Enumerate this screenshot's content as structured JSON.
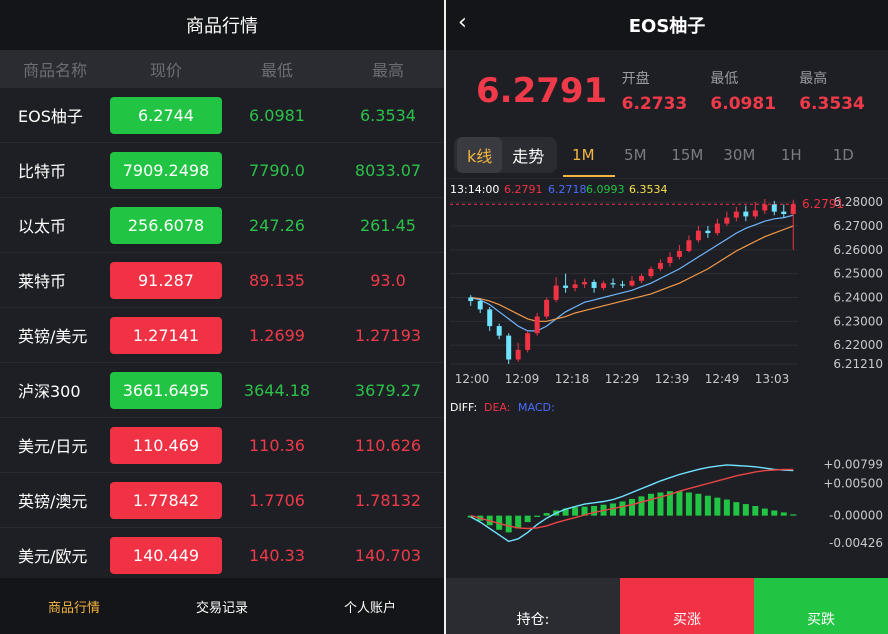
{
  "left": {
    "title": "商品行情",
    "columns": [
      "商品名称",
      "现价",
      "最低",
      "最高"
    ],
    "rows": [
      {
        "name": "EOS柚子",
        "price": "6.2744",
        "low": "6.0981",
        "high": "6.3534",
        "trend": "up"
      },
      {
        "name": "比特币",
        "price": "7909.2498",
        "low": "7790.0",
        "high": "8033.07",
        "trend": "up"
      },
      {
        "name": "以太币",
        "price": "256.6078",
        "low": "247.26",
        "high": "261.45",
        "trend": "up"
      },
      {
        "name": "莱特币",
        "price": "91.287",
        "low": "89.135",
        "high": "93.0",
        "trend": "down"
      },
      {
        "name": "英镑/美元",
        "price": "1.27141",
        "low": "1.2699",
        "high": "1.27193",
        "trend": "down"
      },
      {
        "name": "泸深300",
        "price": "3661.6495",
        "low": "3644.18",
        "high": "3679.27",
        "trend": "up"
      },
      {
        "name": "美元/日元",
        "price": "110.469",
        "low": "110.36",
        "high": "110.626",
        "trend": "down"
      },
      {
        "name": "英镑/澳元",
        "price": "1.77842",
        "low": "1.7706",
        "high": "1.78132",
        "trend": "down"
      },
      {
        "name": "美元/欧元",
        "price": "140.449",
        "low": "140.33",
        "high": "140.703",
        "trend": "down"
      }
    ],
    "bottom_tabs": [
      "商品行情",
      "交易记录",
      "个人账户"
    ]
  },
  "right": {
    "title": "EOS柚子",
    "current_price": "6.2791",
    "stats": [
      {
        "label": "开盘",
        "value": "6.2733"
      },
      {
        "label": "最低",
        "value": "6.0981"
      },
      {
        "label": "最高",
        "value": "6.3534"
      }
    ],
    "mode_tabs": [
      "k线",
      "走势"
    ],
    "timeframes": [
      "1M",
      "5M",
      "15M",
      "30M",
      "1H",
      "1D"
    ],
    "chart_header": {
      "time": "13:14:00",
      "v1": "6.2791",
      "v2": "6.2718",
      "v3": "6.0993",
      "v4": "6.3534"
    },
    "price_axis": [
      "6.28000",
      "6.27000",
      "6.26000",
      "6.25000",
      "6.24000",
      "6.23000",
      "6.22000",
      "6.21210"
    ],
    "last_price_tag": "6.2791",
    "time_axis": [
      "12:00",
      "12:09",
      "12:18",
      "12:29",
      "12:39",
      "12:49",
      "13:03"
    ],
    "macd_legend": {
      "diff": "DIFF:",
      "dea": "DEA:",
      "macd": "MACD:"
    },
    "macd_axis": [
      "+0.00799",
      "+0.00500",
      "-0.00000",
      "-0.00426"
    ],
    "bottom": {
      "hold": "持仓:",
      "buy_up": "买涨",
      "buy_down": "买跌"
    },
    "colors": {
      "up": "#f03244",
      "down": "#21c443",
      "accent": "#f5b640"
    }
  },
  "chart_data": [
    {
      "type": "candlestick",
      "title": "",
      "ylim": [
        6.2121,
        6.2813
      ],
      "x_ticks": [
        "12:00",
        "12:09",
        "12:18",
        "12:29",
        "12:39",
        "12:49",
        "13:03"
      ],
      "candles": [
        {
          "o": 6.24,
          "c": 6.2385,
          "h": 6.241,
          "l": 6.2365
        },
        {
          "o": 6.2385,
          "c": 6.235,
          "h": 6.2395,
          "l": 6.2335
        },
        {
          "o": 6.235,
          "c": 6.228,
          "h": 6.236,
          "l": 6.226
        },
        {
          "o": 6.228,
          "c": 6.224,
          "h": 6.229,
          "l": 6.2225
        },
        {
          "o": 6.224,
          "c": 6.214,
          "h": 6.225,
          "l": 6.2121
        },
        {
          "o": 6.214,
          "c": 6.218,
          "h": 6.221,
          "l": 6.213
        },
        {
          "o": 6.218,
          "c": 6.225,
          "h": 6.226,
          "l": 6.217
        },
        {
          "o": 6.225,
          "c": 6.232,
          "h": 6.2335,
          "l": 6.224
        },
        {
          "o": 6.232,
          "c": 6.239,
          "h": 6.24,
          "l": 6.231
        },
        {
          "o": 6.239,
          "c": 6.245,
          "h": 6.2485,
          "l": 6.238
        },
        {
          "o": 6.245,
          "c": 6.244,
          "h": 6.25,
          "l": 6.242
        },
        {
          "o": 6.244,
          "c": 6.2455,
          "h": 6.2475,
          "l": 6.2425
        },
        {
          "o": 6.2455,
          "c": 6.2465,
          "h": 6.248,
          "l": 6.244
        },
        {
          "o": 6.2465,
          "c": 6.244,
          "h": 6.2475,
          "l": 6.242
        },
        {
          "o": 6.244,
          "c": 6.246,
          "h": 6.247,
          "l": 6.243
        },
        {
          "o": 6.246,
          "c": 6.2455,
          "h": 6.248,
          "l": 6.244
        },
        {
          "o": 6.2455,
          "c": 6.245,
          "h": 6.247,
          "l": 6.244
        },
        {
          "o": 6.245,
          "c": 6.247,
          "h": 6.249,
          "l": 6.2445
        },
        {
          "o": 6.247,
          "c": 6.249,
          "h": 6.25,
          "l": 6.246
        },
        {
          "o": 6.249,
          "c": 6.252,
          "h": 6.253,
          "l": 6.248
        },
        {
          "o": 6.252,
          "c": 6.2545,
          "h": 6.256,
          "l": 6.251
        },
        {
          "o": 6.2545,
          "c": 6.257,
          "h": 6.259,
          "l": 6.253
        },
        {
          "o": 6.257,
          "c": 6.2595,
          "h": 6.262,
          "l": 6.256
        },
        {
          "o": 6.2595,
          "c": 6.264,
          "h": 6.266,
          "l": 6.259
        },
        {
          "o": 6.264,
          "c": 6.268,
          "h": 6.27,
          "l": 6.263
        },
        {
          "o": 6.268,
          "c": 6.267,
          "h": 6.27,
          "l": 6.265
        },
        {
          "o": 6.267,
          "c": 6.271,
          "h": 6.273,
          "l": 6.266
        },
        {
          "o": 6.271,
          "c": 6.2735,
          "h": 6.276,
          "l": 6.27
        },
        {
          "o": 6.2735,
          "c": 6.276,
          "h": 6.278,
          "l": 6.272
        },
        {
          "o": 6.276,
          "c": 6.274,
          "h": 6.2785,
          "l": 6.272
        },
        {
          "o": 6.274,
          "c": 6.2765,
          "h": 6.28,
          "l": 6.273
        },
        {
          "o": 6.2765,
          "c": 6.279,
          "h": 6.2813,
          "l": 6.275
        },
        {
          "o": 6.279,
          "c": 6.276,
          "h": 6.2805,
          "l": 6.2745
        },
        {
          "o": 6.276,
          "c": 6.275,
          "h": 6.279,
          "l": 6.2735
        },
        {
          "o": 6.275,
          "c": 6.2791,
          "h": 6.281,
          "l": 6.26
        }
      ],
      "ma": [
        {
          "values": [
            6.24,
            6.239,
            6.237,
            6.234,
            6.231,
            6.228,
            6.226,
            6.226,
            6.228,
            6.231,
            6.234,
            6.236,
            6.238,
            6.239,
            6.24,
            6.241,
            6.242,
            6.243,
            6.2445,
            6.246,
            6.248,
            6.25,
            6.252,
            6.2545,
            6.257,
            6.2595,
            6.262,
            6.2645,
            6.267,
            6.269,
            6.2705,
            6.272,
            6.273,
            6.2735,
            6.2745
          ],
          "color": "#6fb7ff"
        },
        {
          "values": [
            6.24,
            6.2395,
            6.2385,
            6.237,
            6.235,
            6.233,
            6.231,
            6.23,
            6.23,
            6.231,
            6.232,
            6.2335,
            6.2345,
            6.2355,
            6.2365,
            6.2375,
            6.2385,
            6.2395,
            6.2405,
            6.2415,
            6.243,
            6.2445,
            6.246,
            6.248,
            6.25,
            6.252,
            6.2545,
            6.257,
            6.2595,
            6.2615,
            6.2635,
            6.2655,
            6.267,
            6.2685,
            6.27
          ],
          "color": "#f39a4a"
        }
      ]
    },
    {
      "type": "bar",
      "title": "",
      "ylim": [
        -0.0055,
        0.0085
      ],
      "macd": [
        -0.0003,
        -0.0008,
        -0.0015,
        -0.0022,
        -0.0026,
        -0.002,
        -0.001,
        -0.0002,
        0.0004,
        0.0008,
        0.0011,
        0.0013,
        0.0014,
        0.0015,
        0.0017,
        0.0019,
        0.0022,
        0.0026,
        0.003,
        0.0034,
        0.0036,
        0.0038,
        0.0038,
        0.0036,
        0.0034,
        0.0031,
        0.0028,
        0.0025,
        0.0021,
        0.0018,
        0.0015,
        0.0011,
        0.0008,
        0.0005,
        0.0002
      ],
      "diff": [
        -0.0002,
        -0.001,
        -0.002,
        -0.003,
        -0.004,
        -0.0036,
        -0.0026,
        -0.0014,
        -0.0004,
        0.0004,
        0.001,
        0.0014,
        0.0018,
        0.002,
        0.0022,
        0.0025,
        0.003,
        0.0036,
        0.0042,
        0.0048,
        0.0054,
        0.0059,
        0.0064,
        0.0068,
        0.0072,
        0.0075,
        0.0077,
        0.0079,
        0.0078,
        0.0077,
        0.0076,
        0.0074,
        0.0072,
        0.0071,
        0.007
      ],
      "dea": [
        0.0,
        -0.0004,
        -0.0008,
        -0.0012,
        -0.0016,
        -0.0019,
        -0.002,
        -0.0019,
        -0.0016,
        -0.0011,
        -0.0007,
        -0.0003,
        0.0001,
        0.0005,
        0.0008,
        0.0011,
        0.0014,
        0.0017,
        0.0021,
        0.0025,
        0.0029,
        0.0033,
        0.0038,
        0.0042,
        0.0046,
        0.005,
        0.0054,
        0.0058,
        0.0062,
        0.0065,
        0.0068,
        0.007,
        0.0071,
        0.0072,
        0.0072
      ],
      "colors": {
        "diff": "#6fe3ff",
        "dea": "#e84545",
        "bar": "#21c443"
      }
    }
  ]
}
